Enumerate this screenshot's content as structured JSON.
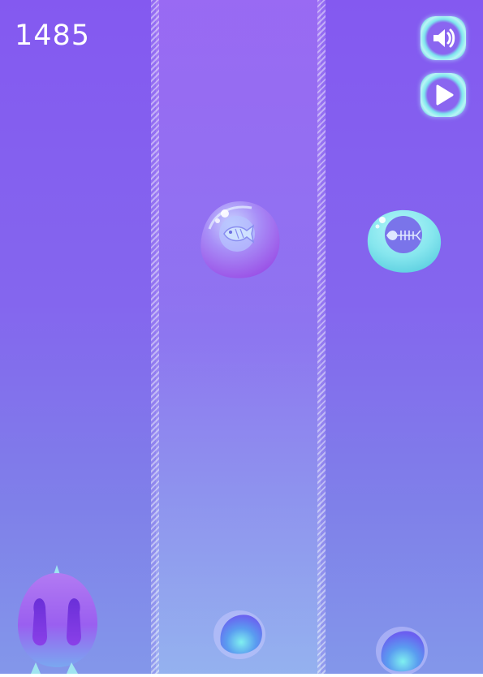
{
  "hud": {
    "score": "1485",
    "sound_icon": "speaker-icon",
    "play_icon": "play-icon"
  },
  "bubbles": [
    {
      "lane": "middle",
      "item": "fish-icon",
      "color": "#a46ef0"
    },
    {
      "lane": "right",
      "item": "fishbone-icon",
      "color": "#6fe3ea"
    }
  ],
  "colors": {
    "background_top": "#8459f0",
    "background_bottom": "#8397ea",
    "accent_cyan": "#7fe6ee",
    "player": "#a56ef0"
  }
}
